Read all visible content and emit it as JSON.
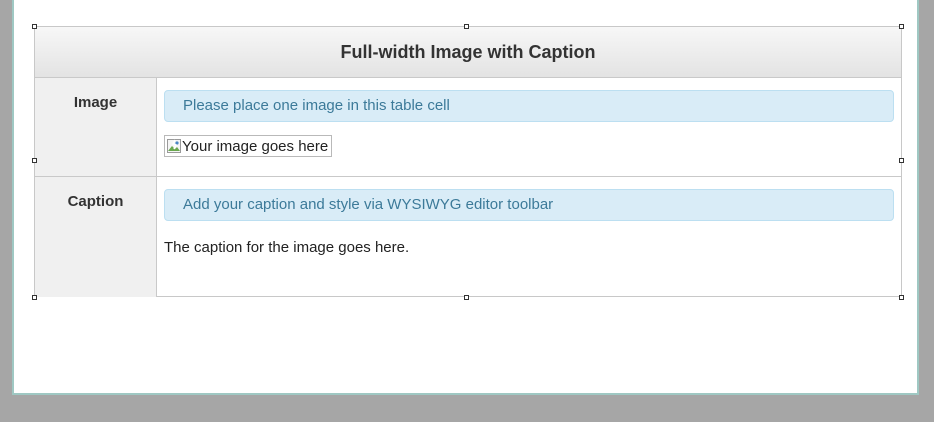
{
  "template": {
    "title": "Full-width Image with Caption",
    "rows": [
      {
        "label": "Image",
        "hint": "Please place one image in this table cell",
        "image_alt": "Your image goes here"
      },
      {
        "label": "Caption",
        "hint": "Add your caption and style via WYSIWYG editor toolbar",
        "text": "The caption for the image goes here."
      }
    ]
  },
  "icons": {
    "broken_image": "broken-image-icon",
    "resize_handle": "resize-handle-icon"
  },
  "colors": {
    "frame": "#a6a6a6",
    "canvas_border": "#9fc8c3",
    "hint_background": "#d9ecf7",
    "hint_text": "#3c7a99"
  }
}
